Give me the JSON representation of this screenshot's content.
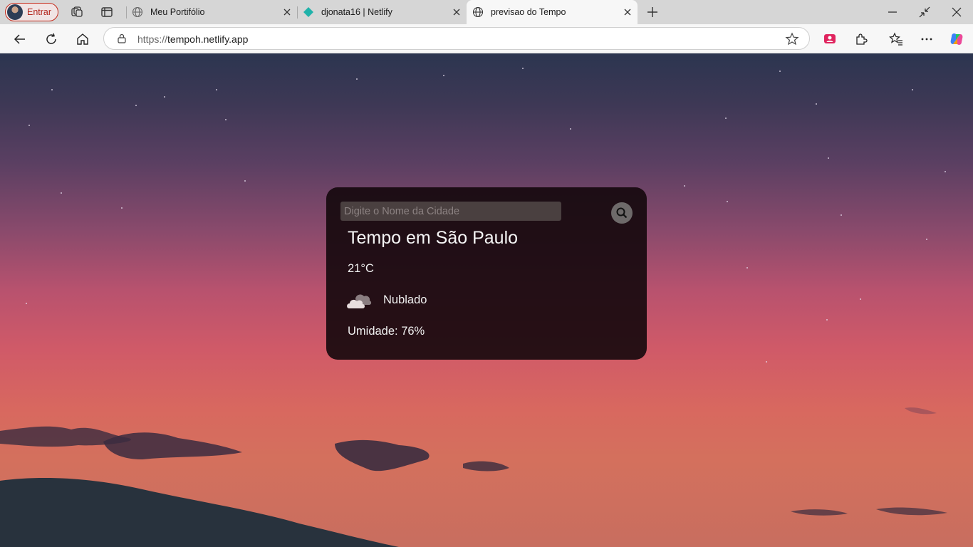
{
  "browser": {
    "profile_label": "Entrar",
    "tabs": [
      {
        "title": "Meu Portifólio"
      },
      {
        "title": "djonata16 | Netlify"
      },
      {
        "title": "previsao do Tempo"
      }
    ],
    "address": {
      "protocol": "https://",
      "host": "tempoh.netlify.app"
    }
  },
  "weather": {
    "search_placeholder": "Digite o Nome da Cidade",
    "city_title": "Tempo em São Paulo",
    "temperature": "21°C",
    "condition": "Nublado",
    "condition_icon": "cloud-icon",
    "humidity": "Umidade: 76%"
  },
  "colors": {
    "card_bg": "#14080c",
    "profile_accent": "#b3261e",
    "netlify_teal": "#20b2aa"
  }
}
